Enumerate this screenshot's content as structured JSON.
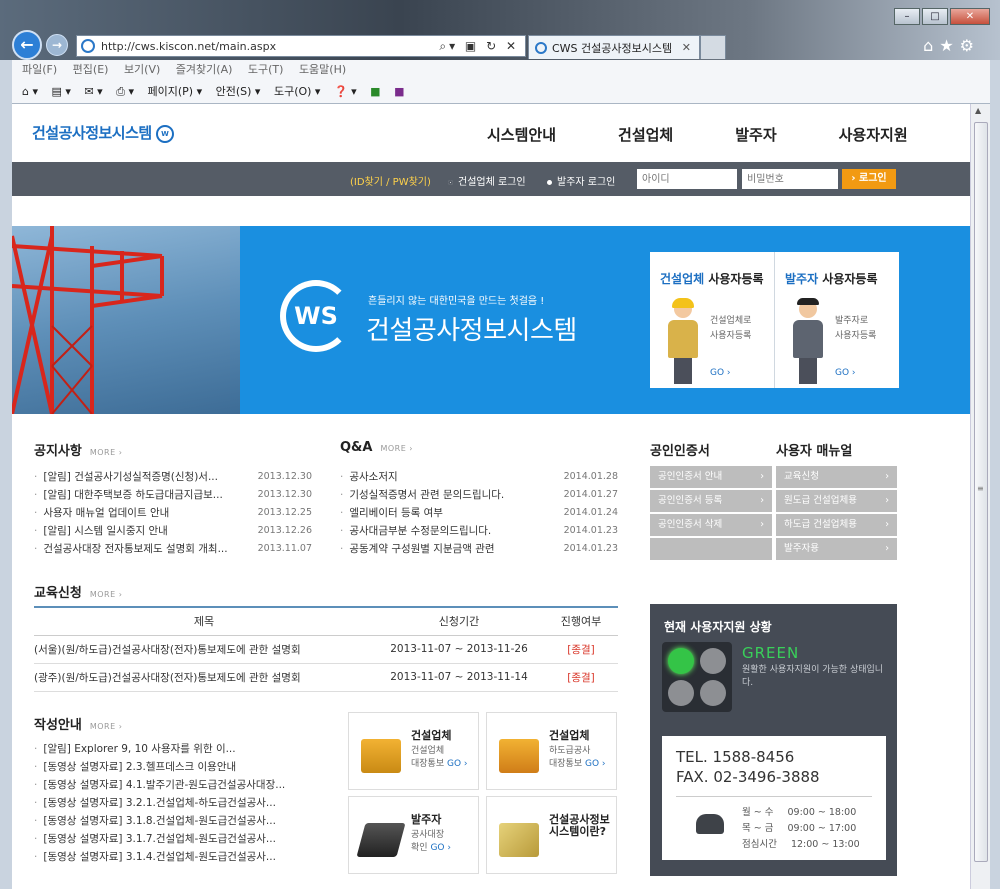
{
  "browser": {
    "url": "http://cws.kiscon.net/main.aspx",
    "tab_title": "CWS 건설공사정보시스템",
    "menu": [
      "파일(F)",
      "편집(E)",
      "보기(V)",
      "즐겨찾기(A)",
      "도구(T)",
      "도움말(H)"
    ],
    "commands": [
      "페이지(P) ▾",
      "안전(S) ▾",
      "도구(O) ▾"
    ]
  },
  "site": {
    "logo": "건설공사정보시스템",
    "nav": [
      "시스템안내",
      "건설업체",
      "발주자",
      "사용자지원"
    ],
    "login": {
      "find_link": "(ID찾기 / PW찾기)",
      "radio_contractor": "건설업체 로그인",
      "radio_client": "발주자 로그인",
      "id_placeholder": "아이디",
      "pw_placeholder": "비밀번호",
      "button": "› 로그인"
    },
    "banner": {
      "logo_text": "WS",
      "slogan": "흔들리지 않는 대한민국을 만드는 첫걸음 !",
      "title": "건설공사정보시스템",
      "reg_contractor": {
        "title_a": "건설업체",
        "title_b": " 사용자등록",
        "desc1": "건설업체로",
        "desc2": "사용자등록",
        "go": "GO ›"
      },
      "reg_client": {
        "title_a": "발주자",
        "title_b": " 사용자등록",
        "desc1": "발주자로",
        "desc2": "사용자등록",
        "go": "GO ›"
      }
    },
    "notice": {
      "title": "공지사항",
      "more": "MORE ›",
      "items": [
        {
          "text": "[알림] 건설공사기성실적증명(신청)서...",
          "date": "2013.12.30"
        },
        {
          "text": "[알림] 대한주택보증 하도급대금지급보...",
          "date": "2013.12.30"
        },
        {
          "text": "사용자 매뉴얼 업데이트 안내",
          "date": "2013.12.25"
        },
        {
          "text": "[알림] 시스템 일시중지 안내",
          "date": "2013.12.26"
        },
        {
          "text": "건설공사대장 전자통보제도 설명회 개최...",
          "date": "2013.11.07"
        }
      ]
    },
    "qna": {
      "title": "Q&A",
      "more": "MORE ›",
      "items": [
        {
          "text": "공사소저지",
          "date": "2014.01.28"
        },
        {
          "text": "기성실적증명서 관련 문의드립니다.",
          "date": "2014.01.27"
        },
        {
          "text": "엘리베이터 등록 여부",
          "date": "2014.01.24"
        },
        {
          "text": "공사대금부분 수정문의드립니다.",
          "date": "2014.01.23"
        },
        {
          "text": "공동계약 구성원별 지분금액 관련",
          "date": "2014.01.23"
        }
      ]
    },
    "cert": {
      "title": "공인인증서",
      "items": [
        "공인인증서 안내",
        "공인인증서 등록",
        "공인인증서 삭제"
      ]
    },
    "manual": {
      "title": "사용자 매뉴얼",
      "items": [
        "교육신청",
        "원도급 건설업체용",
        "하도급 건설업체용",
        "발주자용"
      ]
    },
    "education": {
      "title": "교육신청",
      "more": "MORE ›",
      "headers": [
        "제목",
        "신청기간",
        "진행여부"
      ],
      "rows": [
        {
          "title": "(서울)(원/하도급)건설공사대장(전자)통보제도에 관한 설명회",
          "period": "2013-11-07 ~ 2013-11-26",
          "status": "[종결]"
        },
        {
          "title": "(광주)(원/하도급)건설공사대장(전자)통보제도에 관한 설명회",
          "period": "2013-11-07 ~ 2013-11-14",
          "status": "[종결]"
        }
      ]
    },
    "guide": {
      "title": "작성안내",
      "more": "MORE ›",
      "items": [
        "[알림] Explorer 9, 10 사용자를 위한 이...",
        "[동영상 설명자료] 2.3.헬프데스크 이용안내",
        "[동영상 설명자료] 4.1.발주기관-원도급건설공사대장...",
        "[동영상 설명자료] 3.2.1.건설업체-하도급건설공사...",
        "[동영상 설명자료] 3.1.8.건설업체-원도급건설공사...",
        "[동영상 설명자료] 3.1.7.건설업체-원도급건설공사...",
        "[동영상 설명자료] 3.1.4.건설업체-원도급건설공사..."
      ]
    },
    "cards": [
      {
        "title": "건설업체",
        "d1": "건설업체",
        "d2": "대장통보",
        "go": "GO ›"
      },
      {
        "title": "건설업체",
        "d1": "하도급공사",
        "d2": "대장통보",
        "go": "GO ›"
      },
      {
        "title": "발주자",
        "d1": "공사대장",
        "d2": "확인",
        "go": "GO ›"
      },
      {
        "title": "건설공사정보",
        "d1": "시스템이란?",
        "d2": "",
        "go": ""
      }
    ],
    "support": {
      "title": "현재 사용자지원 상황",
      "status": "GREEN",
      "desc": "원활한 사용자지원이 가능한 상태입니다.",
      "tel": "TEL. 1588-8456",
      "fax": "FAX. 02-3496-3888",
      "hours": [
        {
          "day": "월 ~ 수",
          "time": "09:00 ~ 18:00"
        },
        {
          "day": "목 ~ 금",
          "time": "09:00 ~ 17:00"
        },
        {
          "day": "점심시간",
          "time": "12:00 ~ 13:00"
        }
      ]
    }
  },
  "colors": {
    "brand": "#1c6fc2",
    "banner": "#1a8fe0",
    "login_bar": "#555c66",
    "accent": "#f29a12",
    "status_green": "#39d05a"
  }
}
